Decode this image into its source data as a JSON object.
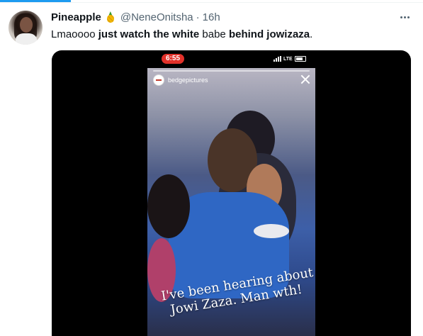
{
  "tweet": {
    "display_name": "Pineapple",
    "name_emoji": "pineapple-emoji",
    "handle": "@NeneOnitsha",
    "separator": "·",
    "timestamp": "16h",
    "text_parts": [
      {
        "text": "Lmaoooo ",
        "bold": false
      },
      {
        "text": "just watch the white",
        "bold": true
      },
      {
        "text": " babe ",
        "bold": false
      },
      {
        "text": "behind jowizaza",
        "bold": true
      },
      {
        "text": ".",
        "bold": false
      }
    ]
  },
  "media": {
    "phone_status_time": "6:55",
    "network": "LTE",
    "story_username": "bedgepictures",
    "caption_line1": "I've been hearing  about",
    "caption_line2": "Jowi Zaza. Man wth!"
  },
  "colors": {
    "accent": "#1d9bf0",
    "status_time_bg": "#e2312a",
    "secondary_text": "#536471"
  }
}
